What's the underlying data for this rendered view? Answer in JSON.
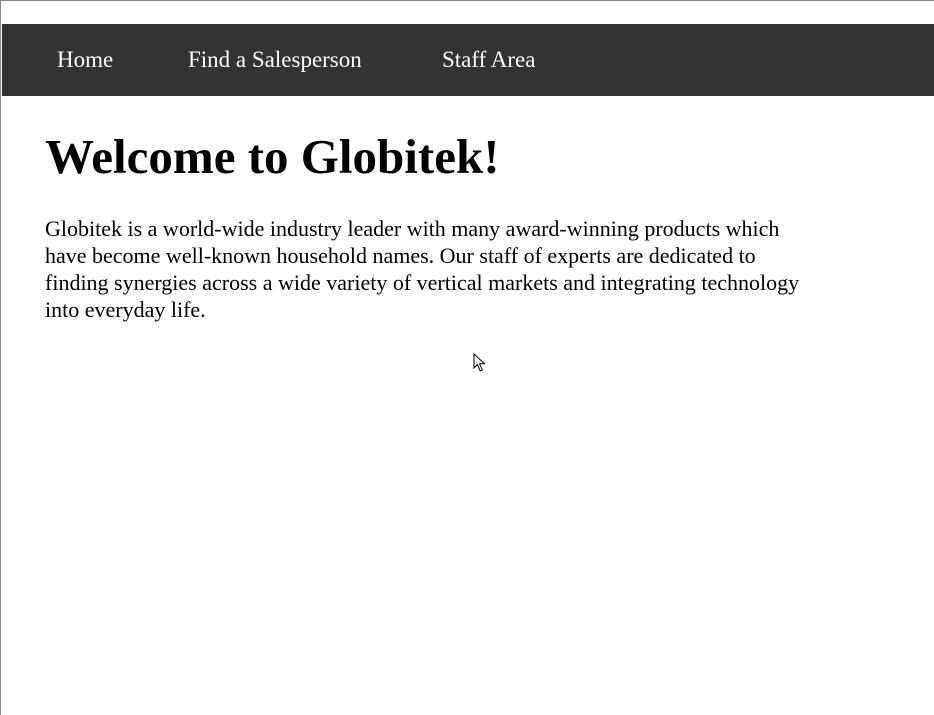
{
  "nav": {
    "items": [
      {
        "label": "Home"
      },
      {
        "label": "Find a Salesperson"
      },
      {
        "label": "Staff Area"
      }
    ],
    "background": "#333333",
    "text_color": "#ffffff"
  },
  "main": {
    "title": "Welcome to Globitek!",
    "intro": "Globitek is a world-wide industry leader with many award-winning products which have become well-known household names. Our staff of experts are dedicated to finding synergies across a wide variety of vertical markets and integrating technology into everyday life."
  },
  "icons": {
    "cursor": "mouse-pointer-icon"
  }
}
